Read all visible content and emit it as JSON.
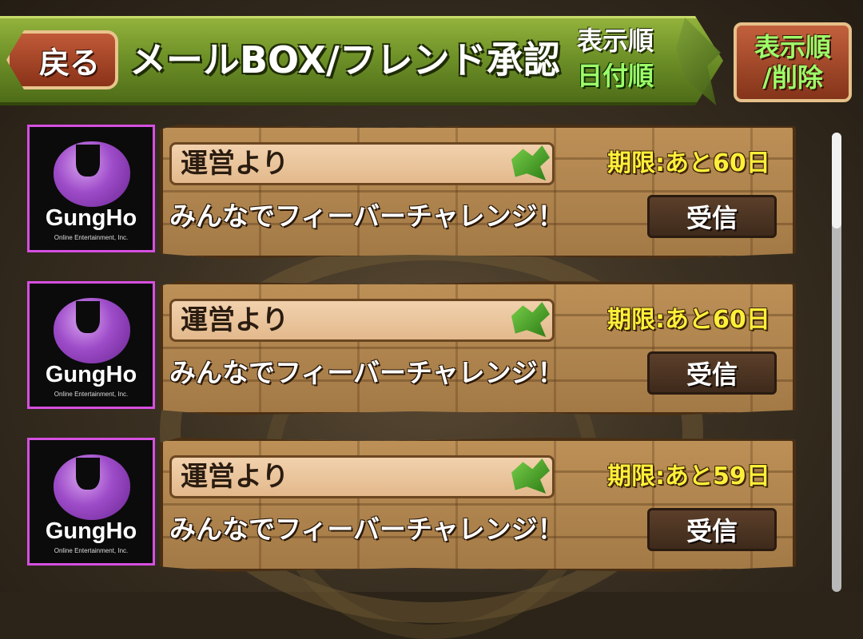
{
  "header": {
    "back_label": "戻る",
    "title": "メールBOX/フレンド承認",
    "sort_label": "表示順",
    "sort_value": "日付順",
    "sort_delete_line1": "表示順",
    "sort_delete_line2": "/削除"
  },
  "mails": [
    {
      "logo_text": "GungHo",
      "logo_sub": "Online Entertainment, Inc.",
      "sender": "運営より",
      "deadline": "期限:あと60日",
      "message": "みんなでフィーバーチャレンジ！",
      "receive_label": "受信"
    },
    {
      "logo_text": "GungHo",
      "logo_sub": "Online Entertainment, Inc.",
      "sender": "運営より",
      "deadline": "期限:あと60日",
      "message": "みんなでフィーバーチャレンジ！",
      "receive_label": "受信"
    },
    {
      "logo_text": "GungHo",
      "logo_sub": "Online Entertainment, Inc.",
      "sender": "運営より",
      "deadline": "期限:あと59日",
      "message": "みんなでフィーバーチャレンジ！",
      "receive_label": "受信"
    }
  ],
  "colors": {
    "header_green": "#6f9228",
    "deadline_yellow": "#ffef3a",
    "sort_value_green": "#9dff6a",
    "avatar_border": "#d64fe0"
  }
}
